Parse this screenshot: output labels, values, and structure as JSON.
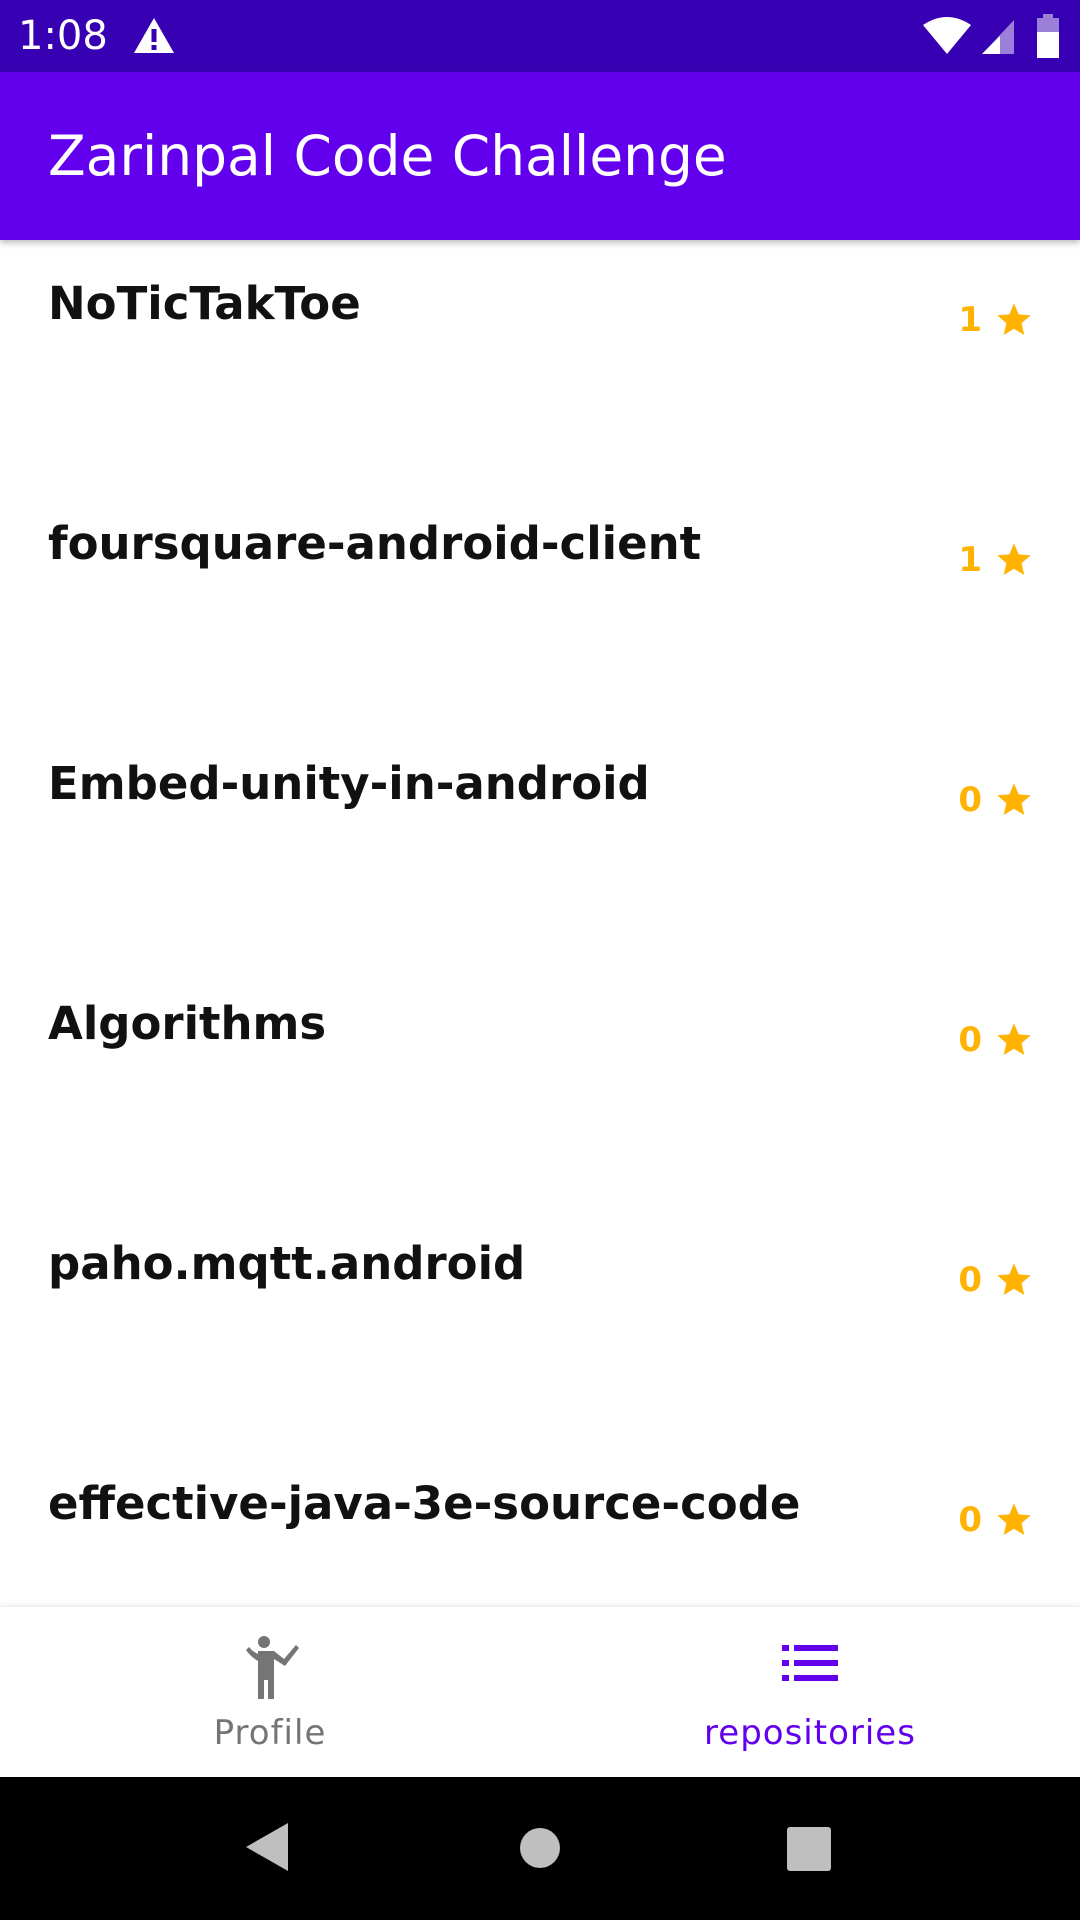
{
  "status_bar": {
    "time": "1:08",
    "icons": [
      "warning-icon",
      "wifi-icon",
      "signal-icon",
      "battery-icon"
    ]
  },
  "app_bar": {
    "title": "Zarinpal Code Challenge"
  },
  "repositories": [
    {
      "name": "NoTicTakToe",
      "stars": "1"
    },
    {
      "name": "foursquare-android-client",
      "stars": "1"
    },
    {
      "name": "Embed-unity-in-android",
      "stars": "0"
    },
    {
      "name": "Algorithms",
      "stars": "0"
    },
    {
      "name": "paho.mqtt.android",
      "stars": "0"
    },
    {
      "name": "effective-java-3e-source-code",
      "stars": "0"
    }
  ],
  "bottom_nav": {
    "items": [
      {
        "label": "Profile",
        "icon": "person-icon",
        "active": false
      },
      {
        "label": "repositories",
        "icon": "list-icon",
        "active": true
      }
    ]
  },
  "system_nav": {
    "icons": [
      "back-icon",
      "home-icon",
      "recents-icon"
    ]
  },
  "colors": {
    "status_bar": "#3700b3",
    "app_bar": "#6200ee",
    "star": "#ffb300",
    "nav_active": "#6200ee",
    "nav_inactive": "#757575"
  }
}
